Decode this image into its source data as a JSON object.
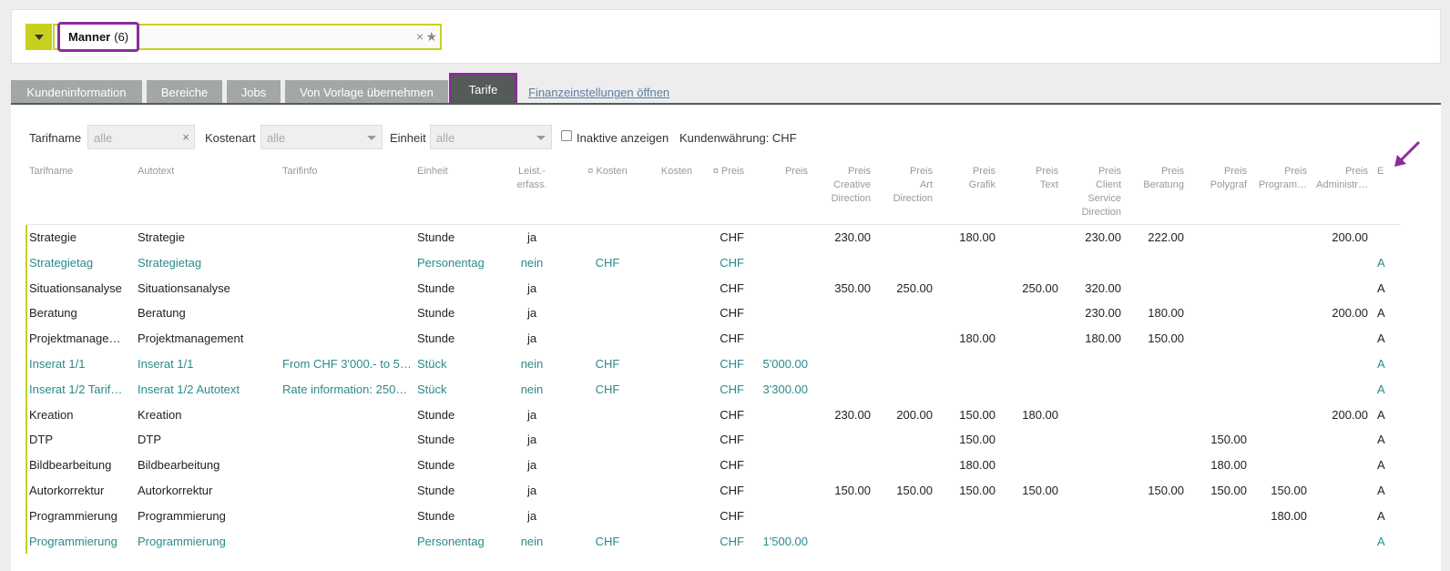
{
  "selector": {
    "name": "Manner",
    "count": "(6)",
    "clear": "×",
    "star": "★"
  },
  "tabs": [
    "Kundeninformation",
    "Bereiche",
    "Jobs",
    "Von Vorlage übernehmen",
    "Tarife"
  ],
  "tab_link": "Finanzeinstellungen öffnen",
  "filters": {
    "tarifname_label": "Tarifname",
    "tarifname_value": "alle",
    "kostenart_label": "Kostenart",
    "kostenart_value": "alle",
    "einheit_label": "Einheit",
    "einheit_value": "alle",
    "inactive_label": "Inaktive anzeigen",
    "currency_label": "Kundenwährung: CHF"
  },
  "columns": [
    "Tarifname",
    "Autotext",
    "Tarifinfo",
    "Einheit",
    "Leist.-\nerfass.",
    "¤ Kosten",
    "Kosten",
    "¤ Preis",
    "Preis",
    "Preis\nCreative\nDirection",
    "Preis\nArt\nDirection",
    "Preis\nGrafik",
    "Preis\nText",
    "Preis\nClient\nService\nDirection",
    "Preis\nBeratung",
    "Preis\nPolygraf",
    "Preis\nProgram…",
    "Preis\nAdministr…",
    "E"
  ],
  "rows": [
    {
      "teal": false,
      "cells": [
        "Strategie",
        "Strategie",
        "",
        "Stunde",
        "ja",
        "",
        "",
        "CHF",
        "",
        "230.00",
        "",
        "180.00",
        "",
        "230.00",
        "222.00",
        "",
        "",
        "200.00",
        ""
      ]
    },
    {
      "teal": true,
      "cells": [
        "Strategietag",
        "Strategietag",
        "",
        "Personentag",
        "nein",
        "CHF",
        "",
        "CHF",
        "",
        "",
        "",
        "",
        "",
        "",
        "",
        "",
        "",
        "",
        "A"
      ]
    },
    {
      "teal": false,
      "cells": [
        "Situationsanalyse",
        "Situationsanalyse",
        "",
        "Stunde",
        "ja",
        "",
        "",
        "CHF",
        "",
        "350.00",
        "250.00",
        "",
        "250.00",
        "320.00",
        "",
        "",
        "",
        "",
        "A"
      ]
    },
    {
      "teal": false,
      "cells": [
        "Beratung",
        "Beratung",
        "",
        "Stunde",
        "ja",
        "",
        "",
        "CHF",
        "",
        "",
        "",
        "",
        "",
        "230.00",
        "180.00",
        "",
        "",
        "200.00",
        "A"
      ]
    },
    {
      "teal": false,
      "cells": [
        "Projektmanage…",
        "Projektmanagement",
        "",
        "Stunde",
        "ja",
        "",
        "",
        "CHF",
        "",
        "",
        "",
        "180.00",
        "",
        "180.00",
        "150.00",
        "",
        "",
        "",
        "A"
      ]
    },
    {
      "teal": true,
      "cells": [
        "Inserat 1/1",
        "Inserat 1/1",
        "From CHF 3'000.- to 5…",
        "Stück",
        "nein",
        "CHF",
        "",
        "CHF",
        "5'000.00",
        "",
        "",
        "",
        "",
        "",
        "",
        "",
        "",
        "",
        "A"
      ]
    },
    {
      "teal": true,
      "cells": [
        "Inserat 1/2 Tarif…",
        "Inserat 1/2 Autotext",
        "Rate information: 250…",
        "Stück",
        "nein",
        "CHF",
        "",
        "CHF",
        "3'300.00",
        "",
        "",
        "",
        "",
        "",
        "",
        "",
        "",
        "",
        "A"
      ]
    },
    {
      "teal": false,
      "cells": [
        "Kreation",
        "Kreation",
        "",
        "Stunde",
        "ja",
        "",
        "",
        "CHF",
        "",
        "230.00",
        "200.00",
        "150.00",
        "180.00",
        "",
        "",
        "",
        "",
        "200.00",
        "A"
      ]
    },
    {
      "teal": false,
      "cells": [
        "DTP",
        "DTP",
        "",
        "Stunde",
        "ja",
        "",
        "",
        "CHF",
        "",
        "",
        "",
        "150.00",
        "",
        "",
        "",
        "150.00",
        "",
        "",
        "A"
      ]
    },
    {
      "teal": false,
      "cells": [
        "Bildbearbeitung",
        "Bildbearbeitung",
        "",
        "Stunde",
        "ja",
        "",
        "",
        "CHF",
        "",
        "",
        "",
        "180.00",
        "",
        "",
        "",
        "180.00",
        "",
        "",
        "A"
      ]
    },
    {
      "teal": false,
      "cells": [
        "Autorkorrektur",
        "Autorkorrektur",
        "",
        "Stunde",
        "ja",
        "",
        "",
        "CHF",
        "",
        "150.00",
        "150.00",
        "150.00",
        "150.00",
        "",
        "150.00",
        "150.00",
        "150.00",
        "",
        "A"
      ]
    },
    {
      "teal": false,
      "cells": [
        "Programmierung",
        "Programmierung",
        "",
        "Stunde",
        "ja",
        "",
        "",
        "CHF",
        "",
        "",
        "",
        "",
        "",
        "",
        "",
        "",
        "180.00",
        "",
        "A"
      ]
    },
    {
      "teal": true,
      "cells": [
        "Programmierung",
        "Programmierung",
        "",
        "Personentag",
        "nein",
        "CHF",
        "",
        "CHF",
        "1'500.00",
        "",
        "",
        "",
        "",
        "",
        "",
        "",
        "",
        "",
        "A"
      ]
    }
  ],
  "colors": {
    "accent": "#c6d11f",
    "highlight": "#8c2b9b",
    "tab_active": "#555b57",
    "tab": "#a3a8a4",
    "teal": "#2a8a8a"
  }
}
